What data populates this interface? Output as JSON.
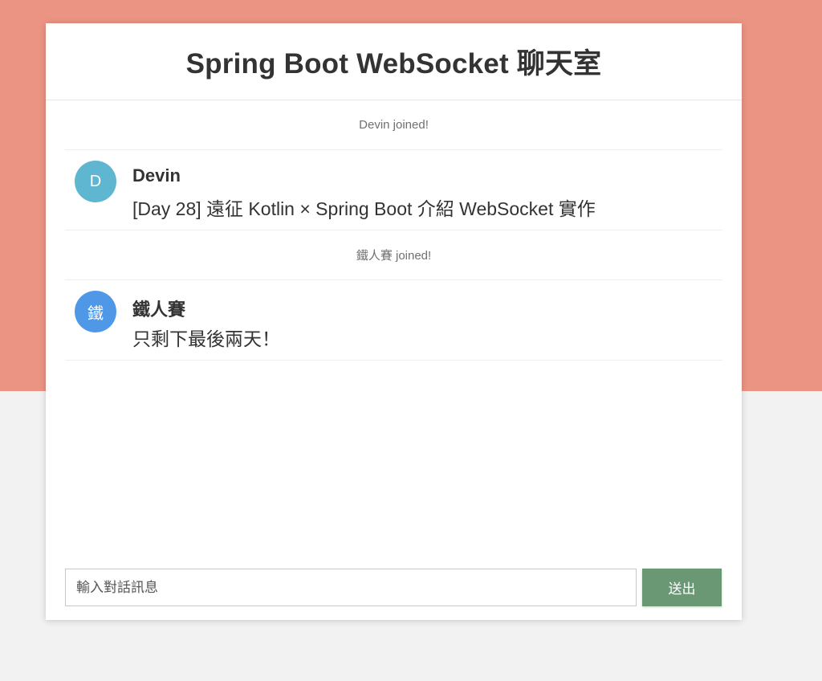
{
  "header": {
    "title": "Spring Boot WebSocket 聊天室"
  },
  "messages": [
    {
      "type": "event",
      "text": "Devin joined!"
    },
    {
      "type": "chat",
      "avatar_letter": "D",
      "avatar_color": "#5fb6d1",
      "sender": "Devin",
      "text": "[Day 28] 遠征 Kotlin × Spring Boot 介紹 WebSocket 實作"
    },
    {
      "type": "event",
      "text": "鐵人賽 joined!"
    },
    {
      "type": "chat",
      "avatar_letter": "鐵",
      "avatar_color": "#4f98e8",
      "sender": "鐵人賽",
      "text": "只剩下最後兩天！"
    }
  ],
  "composer": {
    "placeholder": "輸入對話訊息",
    "value": "",
    "send_label": "送出"
  },
  "colors": {
    "top_background": "#ec9483",
    "bottom_background": "#f2f2f2",
    "send_button": "#6a9874"
  }
}
